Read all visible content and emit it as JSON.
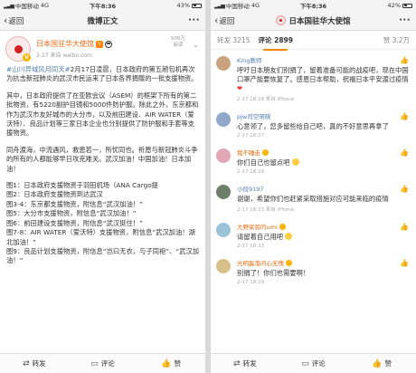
{
  "status_bar": {
    "carrier": "中国移动",
    "network": "4G",
    "time": "下午8:36",
    "battery_left": "43%",
    "battery_right": "42%"
  },
  "left": {
    "nav": {
      "back": "返回",
      "title": "微博正文",
      "more": "···"
    },
    "post": {
      "author": "日本国驻华大使馆",
      "time": "2-17 来自 weibo.com",
      "reads": "506万",
      "reads_label": "阅读",
      "hashtag": "#山川异域风月同天#",
      "p1": "2月17日凌晨，日本政府的第五趟包机再次为抗击新冠肺炎的武汉市民运来了日本各界捐赠的一批支援物资。",
      "p2": "其中，日本政府提供了在亚欧会议（ASEM）的框架下所有的第二批物资，有5220副护目镜和5000件防护服。除此之外，东京都和作为武汉市友好城市的大分市，以及前田建设、AIR WATER（爱沃特）、良品计划等三家日本企业也分别提供了防护服和手套等支援物资。",
      "p3": "同舟渡海，中流遇风，救患若一，所忧同也。祈愿与新冠肺炎斗争的所有的人都能够早日攻克难关。武汉加油！中国加油！日本加油！",
      "captions": [
        "图1：日本政府支援物资于羽田机场（ANA Cargo提",
        "图2：日本政府支援物资到达武汉",
        "图3-4：东京都支援物资，附信息“武汉加油！”",
        "图5：大分市支援物资，附信息“武汉加油！”",
        "图6：前田建设支援物资，附信息“武汉挺住！”",
        "图7-8：AIR WATER（爱沃特）支援物资，附信息“武汉加油！湖北加油！”",
        "图9：良品计划支援物资，附信息“岂曰无衣，与子同袍”、“武汉加油！”"
      ]
    },
    "actions": {
      "repost": "转发",
      "comment": "评论",
      "like": "赞"
    }
  },
  "right": {
    "nav": {
      "back": "返回",
      "title": "日本国驻华大使馆",
      "more": "···"
    },
    "tabs": {
      "repost": "转发 3215",
      "comments": "评论 2899",
      "likes": "赞 3.2万"
    },
    "comments": [
      {
        "name": "King教师",
        "text": "呼吁日本朋友们别捐了，留着准备可能的战疫吧，现在中国口罩产能要恢复了。感恩日本帮助，祝福日本平安渡过疫情",
        "time": "2-17 18:18 来自 iPhone",
        "avatar_color": "#c9a27e",
        "name_color": "#507daf"
      },
      {
        "name": "pjw司空晓晓",
        "text": "心意领了，您多留些给自己吧，真的不好意思再拿了",
        "time": "2-17 18:27",
        "avatar_color": "#8fa7c9",
        "name_color": "#507daf"
      },
      {
        "name": "我不睡走",
        "text": "你们自己也留点吧",
        "time": "2-17 18:18",
        "avatar_color": "#e2a7b5",
        "name_color": "#e86c14"
      },
      {
        "name": "小段9197",
        "text": "谢谢，希望你们也赶紧采取措施对应可能来临的疫情",
        "time": "2-17 18:23 来自 iPhone",
        "avatar_color": "#6e7f6a",
        "name_color": "#507daf"
      },
      {
        "name": "大野家旁的umi",
        "text": "请留着自己用吧",
        "time": "2-17 18:23",
        "avatar_color": "#9dc3d8",
        "name_color": "#e86c14"
      },
      {
        "name": "光明磊落问心无愧",
        "text": "别捐了！你们也需要啊！",
        "time": "2-17 18:19",
        "avatar_color": "#d8c08a",
        "name_color": "#e86c14"
      }
    ],
    "actions": {
      "repost": "转发",
      "comment": "评论",
      "like": "赞"
    }
  }
}
